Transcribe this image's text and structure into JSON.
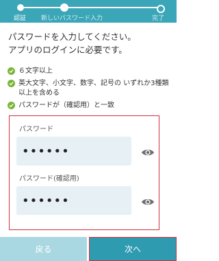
{
  "stepper": {
    "steps": [
      "認証",
      "新しいパスワード入力",
      "完了"
    ]
  },
  "intro": {
    "line1": "パスワードを入力してください。",
    "line2": "アプリのログインに必要です。"
  },
  "rules": [
    {
      "text": "６文字以上"
    },
    {
      "text": "英大文字、小文字、数字、記号の いずれか3種類以上を含める"
    },
    {
      "text": "パスワードが（確認用）と一致"
    }
  ],
  "form": {
    "password_label": "パスワード",
    "password_value": "••••••",
    "confirm_label": "パスワード(確認用)",
    "confirm_value": "••••••"
  },
  "buttons": {
    "back": "戻る",
    "next": "次へ"
  },
  "colors": {
    "accent": "#3aa6b8",
    "check": "#7bb43a",
    "highlight": "#d32f3c"
  }
}
